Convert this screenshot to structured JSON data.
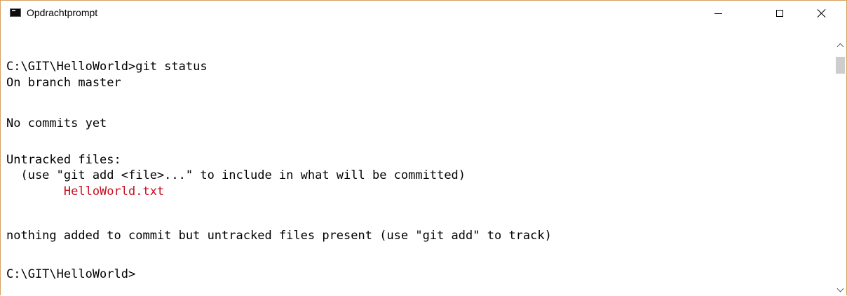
{
  "window": {
    "title": "Opdrachtprompt",
    "icon": "cmd-icon",
    "controls": {
      "minimize": "minimize-icon",
      "maximize": "maximize-icon",
      "close": "close-icon"
    }
  },
  "console": {
    "lines": [
      {
        "text": "C:\\GIT\\HelloWorld>git status"
      },
      {
        "text": "On branch master"
      },
      {
        "text": ""
      },
      {
        "text": "No commits yet"
      },
      {
        "text": ""
      },
      {
        "text": "Untracked files:"
      },
      {
        "text": "  (use \"git add <file>...\" to include in what will be committed)"
      },
      {
        "text": "        HelloWorld.txt",
        "color": "#c50f1f"
      },
      {
        "text": ""
      },
      {
        "text": "nothing added to commit but untracked files present (use \"git add\" to track)"
      },
      {
        "text": ""
      },
      {
        "text": "C:\\GIT\\HelloWorld>"
      }
    ]
  },
  "colors": {
    "untracked_file": "#c50f1f",
    "window_border": "#d8a060"
  }
}
